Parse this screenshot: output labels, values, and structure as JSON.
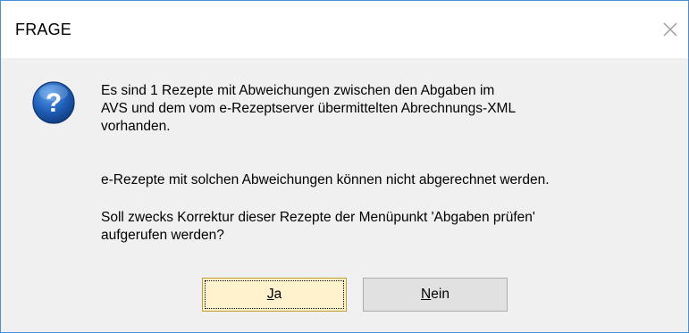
{
  "dialog": {
    "title": "FRAGE",
    "close_icon": "close-x-icon",
    "message_icon": "question-mark-icon",
    "message_paragraph_1": "Es sind 1 Rezepte mit Abweichungen zwischen den Abgaben im\nAVS und dem vom e-Rezeptserver übermittelten Abrechnungs-XML\nvorhanden.",
    "message_paragraph_2": "e-Rezepte mit solchen Abweichungen können nicht abgerechnet werden.",
    "message_paragraph_3": "Soll zwecks Korrektur dieser Rezepte der Menüpunkt 'Abgaben prüfen'\naufgerufen werden?",
    "yes_button": {
      "label": "Ja",
      "mnemonic": "J",
      "rest": "a"
    },
    "no_button": {
      "label": "Nein",
      "mnemonic": "N",
      "rest": "ein"
    }
  },
  "colors": {
    "window_border": "#4a90d9",
    "content_background": "#f0f0f0",
    "icon_blue": "#1f5fb8",
    "default_button_background": "#fff2cc"
  }
}
